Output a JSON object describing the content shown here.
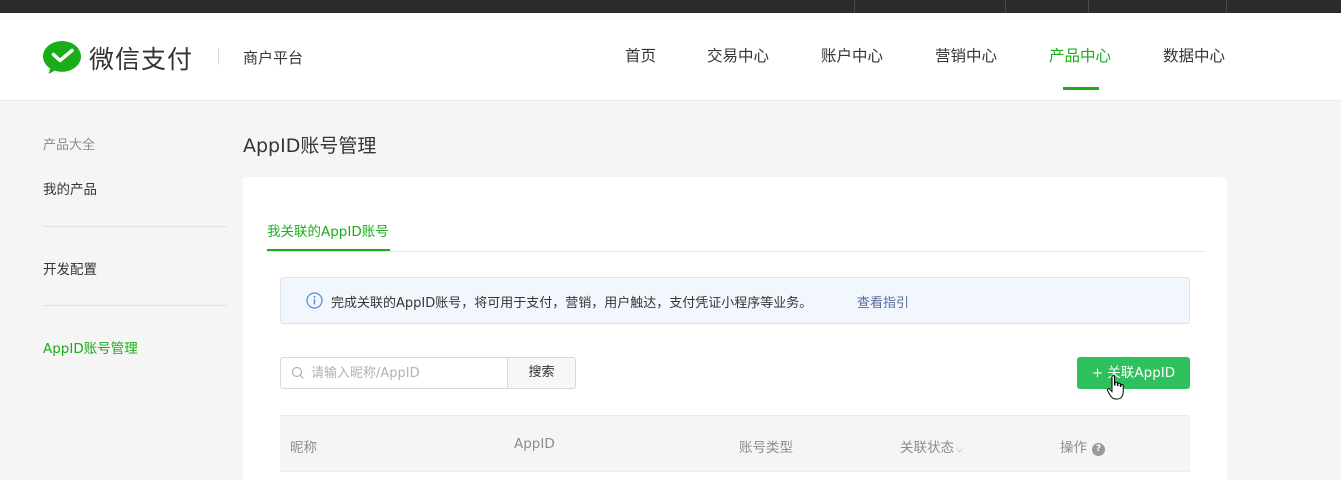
{
  "header": {
    "brand": "微信支付",
    "subbrand": "商户平台",
    "nav": [
      "首页",
      "交易中心",
      "账户中心",
      "营销中心",
      "产品中心",
      "数据中心"
    ],
    "active_nav": "产品中心"
  },
  "sidebar": {
    "title": "产品大全",
    "items": [
      "我的产品",
      "开发配置",
      "AppID账号管理"
    ],
    "active_item": "AppID账号管理"
  },
  "main": {
    "page_title": "AppID账号管理",
    "tab": "我关联的AppID账号",
    "notice": {
      "text": "完成关联的AppID账号，将可用于支付，营销，用户触达，支付凭证小程序等业务。",
      "link": "查看指引"
    },
    "search": {
      "placeholder": "请输入昵称/AppID",
      "button": "搜索"
    },
    "add_button": "+ 关联AppID",
    "table": {
      "columns": [
        "昵称",
        "AppID",
        "账号类型",
        "关联状态",
        "操作"
      ],
      "status_caret": "⌵",
      "help_glyph": "?"
    }
  },
  "colors": {
    "accent": "#1aad19",
    "button": "#2dc05c",
    "link": "#576b95",
    "notice_bg": "#f2f7fd"
  }
}
